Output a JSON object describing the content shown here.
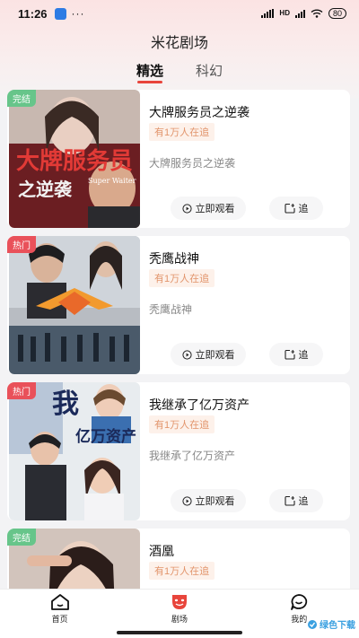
{
  "status_bar": {
    "time": "11:26",
    "dots": "···",
    "network_label": "HD",
    "battery": "80"
  },
  "header": {
    "title": "米花剧场",
    "tabs": [
      {
        "label": "精选",
        "active": true
      },
      {
        "label": "科幻",
        "active": false
      }
    ]
  },
  "dramas": [
    {
      "badge": "完结",
      "badge_type": "done",
      "title": "大牌服务员之逆袭",
      "heat": "有1万人在追",
      "desc": "大牌服务员之逆袭",
      "watch_label": "立即观看",
      "follow_label": "追",
      "poster_text": "大牌服务员",
      "poster_text2": "之逆袭",
      "poster_sub": "Super Waiter"
    },
    {
      "badge": "热门",
      "badge_type": "hot",
      "title": "秃鹰战神",
      "heat": "有1万人在追",
      "desc": "秃鹰战神",
      "watch_label": "立即观看",
      "follow_label": "追",
      "poster_text": "",
      "poster_text2": "",
      "poster_sub": ""
    },
    {
      "badge": "热门",
      "badge_type": "hot",
      "title": "我继承了亿万资产",
      "heat": "有1万人在追",
      "desc": "我继承了亿万资产",
      "watch_label": "立即观看",
      "follow_label": "追",
      "poster_text": "我",
      "poster_text2": "亿万资产",
      "poster_sub": ""
    },
    {
      "badge": "完结",
      "badge_type": "done",
      "title": "酒凰",
      "heat": "有1万人在追",
      "desc": "",
      "watch_label": "",
      "follow_label": "",
      "poster_text": "",
      "poster_text2": "",
      "poster_sub": ""
    }
  ],
  "bottom_nav": [
    {
      "label": "首页",
      "icon": "home-icon",
      "active": false
    },
    {
      "label": "剧场",
      "icon": "theater-mask-icon",
      "active": true
    },
    {
      "label": "我的",
      "icon": "chat-smile-icon",
      "active": false
    }
  ],
  "watermark": "绿色下载",
  "colors": {
    "accent": "#e8453c",
    "badge_done": "#67c58a",
    "badge_hot": "#e9515a",
    "heat_text": "#e2956c",
    "heat_bg": "#fdf1ea"
  }
}
